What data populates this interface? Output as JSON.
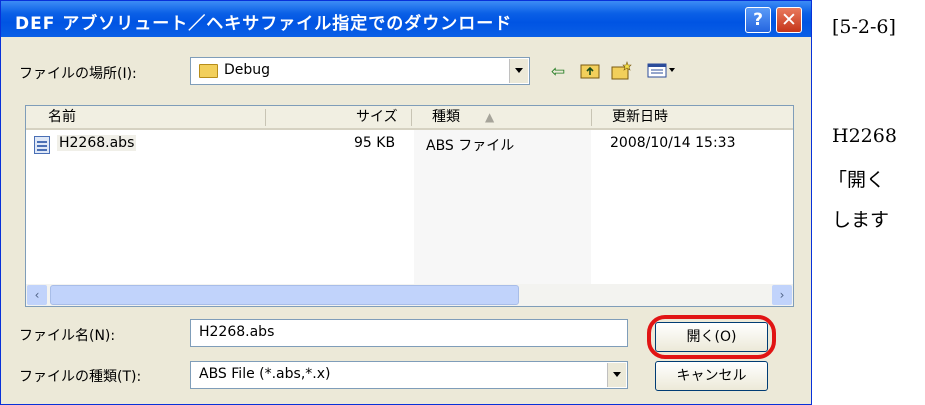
{
  "dialog": {
    "title": "DEF アブソリュート／ヘキサファイル指定でのダウンロード",
    "help_label": "?",
    "close_label": "✕"
  },
  "look_in": {
    "label": "ファイルの場所(I):",
    "value": "Debug"
  },
  "toolbar": {
    "back_icon": "back-arrow-icon",
    "up_icon": "up-folder-icon",
    "new_folder_icon": "new-folder-icon",
    "view_icon": "view-menu-icon"
  },
  "file_list": {
    "columns": [
      "名前",
      "サイズ",
      "種類",
      "更新日時"
    ],
    "sort_indicator": "▲",
    "rows": [
      {
        "name": "H2268.abs",
        "size": "95 KB",
        "type": "ABS ファイル",
        "modified": "2008/10/14 15:33"
      }
    ]
  },
  "scrollbar": {
    "left_arrow": "‹",
    "right_arrow": "›"
  },
  "filename": {
    "label": "ファイル名(N):",
    "value": "H2268.abs"
  },
  "filetype": {
    "label": "ファイルの種類(T):",
    "value": "ABS File (*.abs,*.x)"
  },
  "buttons": {
    "open": "開く(O)",
    "cancel": "キャンセル"
  },
  "side_text": {
    "ref": "[5-2-6]",
    "line1": "H2268",
    "line2": "「開く",
    "line3": "します"
  },
  "colors": {
    "title_bar": "#0054e3",
    "dialog_bg": "#ece9d8",
    "highlight": "#e11414"
  }
}
